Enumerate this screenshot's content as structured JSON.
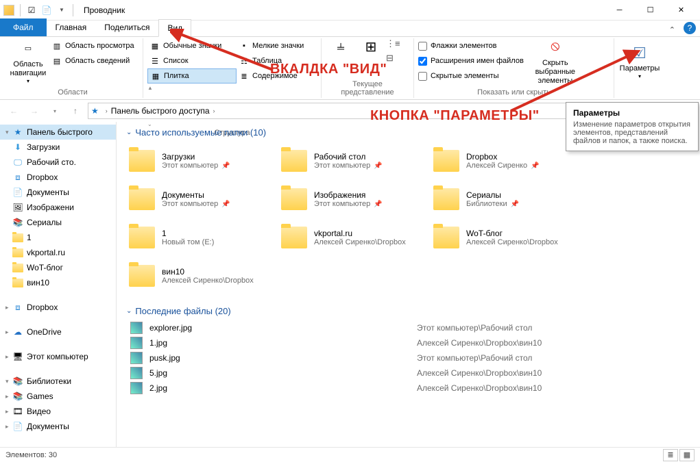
{
  "titlebar": {
    "title": "Проводник"
  },
  "tabs": {
    "file": "Файл",
    "home": "Главная",
    "share": "Поделиться",
    "view": "Вид"
  },
  "ribbon": {
    "panes_group": "Области",
    "nav_pane": "Область навигации",
    "preview_pane": "Область просмотра",
    "details_pane": "Область сведений",
    "layout_group": "Структура",
    "extra_large": "Обычные значки",
    "medium": "Мелкие значки",
    "list": "Список",
    "details": "Таблица",
    "tiles": "Плитка",
    "content": "Содержимое",
    "current_view_group": "Текущее представление",
    "show_hide_group": "Показать или скрыть",
    "checkboxes": "Флажки элементов",
    "extensions": "Расширения имен файлов",
    "hidden": "Скрытые элементы",
    "hide_selected": "Скрыть выбранные элементы",
    "options": "Параметры"
  },
  "breadcrumb": {
    "root": "Панель быстрого доступа"
  },
  "sidebar": {
    "quick": "Панель быстрого",
    "downloads": "Загрузки",
    "desktop": "Рабочий сто.",
    "dropbox": "Dropbox",
    "documents": "Документы",
    "pictures": "Изображени",
    "serials": "Сериалы",
    "one": "1",
    "vkportal": "vkportal.ru",
    "wotblog": "WoT-блог",
    "win10": "вин10",
    "dropbox2": "Dropbox",
    "onedrive": "OneDrive",
    "thispc": "Этот компьютер",
    "libraries": "Библиотеки",
    "games": "Games",
    "videos": "Видео",
    "documents2": "Документы"
  },
  "sections": {
    "frequent": "Часто используемые папки (10)",
    "recent": "Последние файлы (20)"
  },
  "folders": [
    {
      "name": "Загрузки",
      "sub": "Этот компьютер",
      "pinned": true,
      "icon": "downloads"
    },
    {
      "name": "Рабочий стол",
      "sub": "Этот компьютер",
      "pinned": true,
      "icon": "desktop"
    },
    {
      "name": "Dropbox",
      "sub": "Алексей Сиренко",
      "pinned": true,
      "icon": "dropbox"
    },
    {
      "name": "Документы",
      "sub": "Этот компьютер",
      "pinned": true,
      "icon": "docs"
    },
    {
      "name": "Изображения",
      "sub": "Этот компьютер",
      "pinned": true,
      "icon": "pics"
    },
    {
      "name": "Сериалы",
      "sub": "Библиотеки",
      "pinned": true,
      "icon": "library"
    },
    {
      "name": "1",
      "sub": "Новый том (E:)",
      "pinned": false,
      "icon": "folder"
    },
    {
      "name": "vkportal.ru",
      "sub": "Алексей Сиренко\\Dropbox",
      "pinned": false,
      "icon": "folder"
    },
    {
      "name": "WoT-блог",
      "sub": "Алексей Сиренко\\Dropbox",
      "pinned": false,
      "icon": "folder"
    },
    {
      "name": "вин10",
      "sub": "Алексей Сиренко\\Dropbox",
      "pinned": false,
      "icon": "folder"
    }
  ],
  "files": [
    {
      "name": "explorer.jpg",
      "path": "Этот компьютер\\Рабочий стол"
    },
    {
      "name": "1.jpg",
      "path": "Алексей Сиренко\\Dropbox\\вин10"
    },
    {
      "name": "pusk.jpg",
      "path": "Этот компьютер\\Рабочий стол"
    },
    {
      "name": "5.jpg",
      "path": "Алексей Сиренко\\Dropbox\\вин10"
    },
    {
      "name": "2.jpg",
      "path": "Алексей Сиренко\\Dropbox\\вин10"
    }
  ],
  "status": {
    "count": "Элементов: 30"
  },
  "tooltip": {
    "title": "Параметры",
    "body": "Изменение параметров открытия элементов, представлений файлов и папок, а также поиска."
  },
  "anno": {
    "view_tab": "ВКАЛДКА \"ВИД\"",
    "params_btn": "КНОПКА \"ПАРАМЕТРЫ\""
  }
}
